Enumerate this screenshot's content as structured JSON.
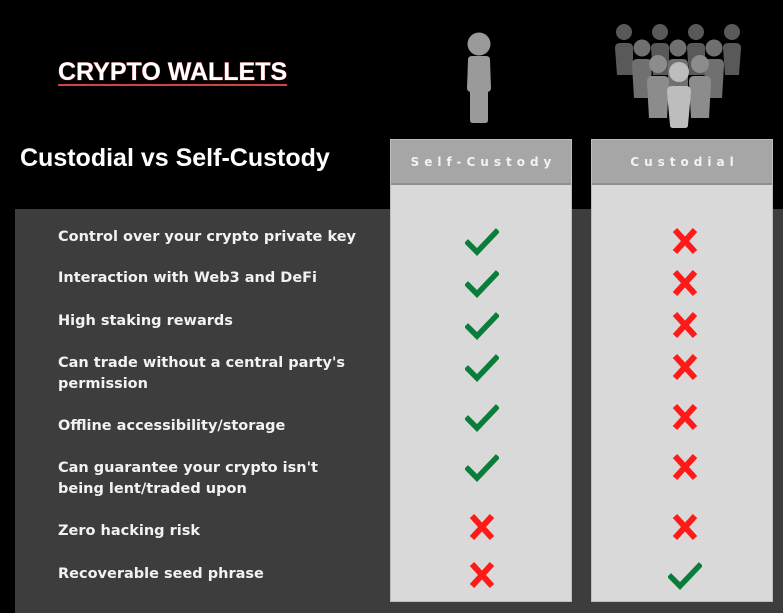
{
  "header": {
    "title": "CRYPTO WALLETS",
    "subtitle": "Custodial vs Self-Custody"
  },
  "columns": [
    {
      "label": "Self-Custody",
      "icon": "single-person-icon"
    },
    {
      "label": "Custodial",
      "icon": "crowd-icon"
    }
  ],
  "colors": {
    "check": "#0a7d3a",
    "cross": "#ff1a1a",
    "panel": "#3d3d3d",
    "column": "#d9d9d9",
    "column_header": "#a6a6a6"
  },
  "rows": [
    {
      "feature": "Control over your crypto private key",
      "self_custody": "check",
      "custodial": "cross"
    },
    {
      "feature": "Interaction with Web3 and DeFi",
      "self_custody": "check",
      "custodial": "cross"
    },
    {
      "feature": "High staking rewards",
      "self_custody": "check",
      "custodial": "cross"
    },
    {
      "feature": "Can trade without a central party's permission",
      "self_custody": "check",
      "custodial": "cross"
    },
    {
      "feature": "Offline accessibility/storage",
      "self_custody": "check",
      "custodial": "cross"
    },
    {
      "feature": "Can guarantee your crypto isn't being lent/traded upon",
      "self_custody": "check",
      "custodial": "cross"
    },
    {
      "feature": "Zero hacking risk",
      "self_custody": "cross",
      "custodial": "cross"
    },
    {
      "feature": "Recoverable seed phrase",
      "self_custody": "cross",
      "custodial": "check"
    }
  ]
}
